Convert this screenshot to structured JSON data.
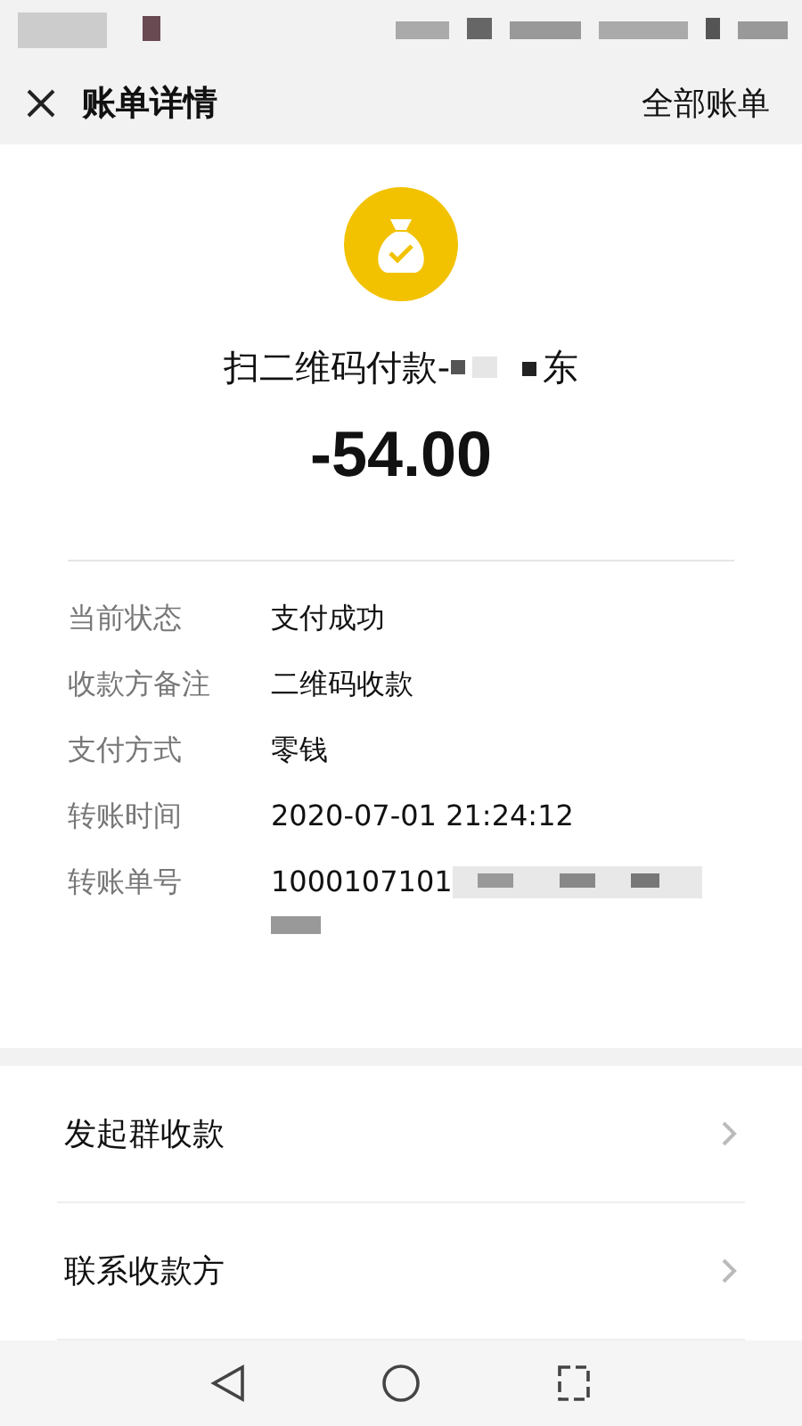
{
  "header": {
    "title": "账单详情",
    "action": "全部账单"
  },
  "summary": {
    "title": "扫二维码付款-",
    "title_end": "东",
    "amount": "-54.00"
  },
  "details": [
    {
      "label": "当前状态",
      "value": "支付成功"
    },
    {
      "label": "收款方备注",
      "value": "二维码收款"
    },
    {
      "label": "支付方式",
      "value": "零钱"
    },
    {
      "label": "转账时间",
      "value": "2020-07-01 21:24:12"
    },
    {
      "label": "转账单号",
      "value": "1000107101",
      "redacted": true
    }
  ],
  "menu": [
    {
      "label": "发起群收款"
    },
    {
      "label": "联系收款方"
    }
  ]
}
